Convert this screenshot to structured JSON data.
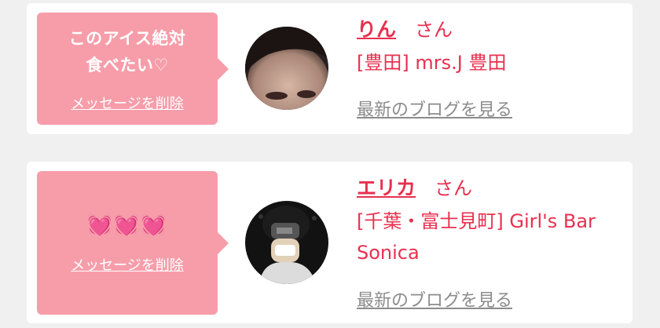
{
  "conversations": [
    {
      "message": "このアイス絶対\n食べたい♡",
      "delete_label": "メッセージを削除",
      "name": "りん",
      "honorific": "さん",
      "shop": "[豊田] mrs.J 豊田",
      "blog_link": "最新のブログを見る"
    },
    {
      "message": "💓💓💓",
      "delete_label": "メッセージを削除",
      "name": "エリカ",
      "honorific": "さん",
      "shop": "[千葉・富士見町] Girl's Bar Sonica",
      "blog_link": "最新のブログを見る"
    }
  ],
  "colors": {
    "accent": "#e8304f",
    "bubble": "#f79daa",
    "link_gray": "#8c8c8c"
  }
}
